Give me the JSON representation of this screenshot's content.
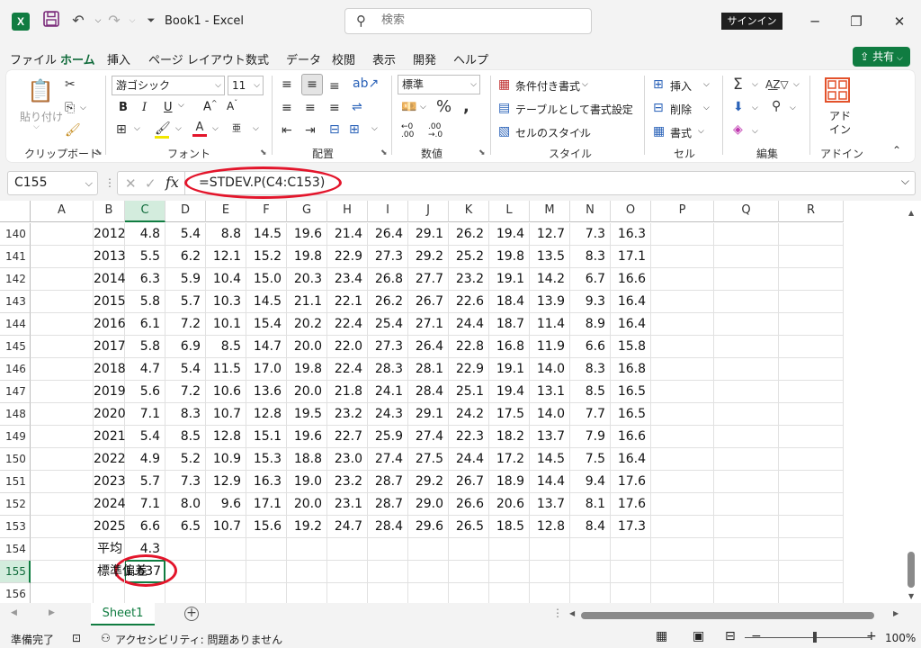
{
  "app": {
    "title": "Book1  -  Excel",
    "logo": "X",
    "sign_in": "サインイン"
  },
  "search": {
    "placeholder": "検索"
  },
  "tabs": [
    "ファイル",
    "ホーム",
    "挿入",
    "ページ レイアウト",
    "数式",
    "データ",
    "校閲",
    "表示",
    "開発",
    "ヘルプ"
  ],
  "active_tab": "ホーム",
  "share": {
    "label": "共有"
  },
  "ribbon": {
    "paste_label": "貼り付け",
    "font_name": "游ゴシック",
    "font_size": "11",
    "number_format": "標準",
    "conditional_format": "条件付き書式",
    "table_format": "テーブルとして書式設定",
    "cell_style": "セルのスタイル",
    "insert": "挿入",
    "delete": "削除",
    "format": "書式",
    "addin_label_1": "アド",
    "addin_label_2": "イン",
    "groups": {
      "clipboard": "クリップボード",
      "font": "フォント",
      "alignment": "配置",
      "number": "数値",
      "styles": "スタイル",
      "cells": "セル",
      "editing": "編集",
      "addins": "アドイン"
    }
  },
  "name_box": "C155",
  "formula": "=STDEV.P(C4:C153)",
  "columns": [
    "A",
    "B",
    "C",
    "D",
    "E",
    "F",
    "G",
    "H",
    "I",
    "J",
    "K",
    "L",
    "M",
    "N",
    "O",
    "P",
    "Q",
    "R"
  ],
  "selected_column": "C",
  "rows": [
    {
      "num": "140",
      "b": "2012",
      "vals": [
        "4.8",
        "5.4",
        "8.8",
        "14.5",
        "19.6",
        "21.4",
        "26.4",
        "29.1",
        "26.2",
        "19.4",
        "12.7",
        "7.3",
        "16.3"
      ]
    },
    {
      "num": "141",
      "b": "2013",
      "vals": [
        "5.5",
        "6.2",
        "12.1",
        "15.2",
        "19.8",
        "22.9",
        "27.3",
        "29.2",
        "25.2",
        "19.8",
        "13.5",
        "8.3",
        "17.1"
      ]
    },
    {
      "num": "142",
      "b": "2014",
      "vals": [
        "6.3",
        "5.9",
        "10.4",
        "15.0",
        "20.3",
        "23.4",
        "26.8",
        "27.7",
        "23.2",
        "19.1",
        "14.2",
        "6.7",
        "16.6"
      ]
    },
    {
      "num": "143",
      "b": "2015",
      "vals": [
        "5.8",
        "5.7",
        "10.3",
        "14.5",
        "21.1",
        "22.1",
        "26.2",
        "26.7",
        "22.6",
        "18.4",
        "13.9",
        "9.3",
        "16.4"
      ]
    },
    {
      "num": "144",
      "b": "2016",
      "vals": [
        "6.1",
        "7.2",
        "10.1",
        "15.4",
        "20.2",
        "22.4",
        "25.4",
        "27.1",
        "24.4",
        "18.7",
        "11.4",
        "8.9",
        "16.4"
      ]
    },
    {
      "num": "145",
      "b": "2017",
      "vals": [
        "5.8",
        "6.9",
        "8.5",
        "14.7",
        "20.0",
        "22.0",
        "27.3",
        "26.4",
        "22.8",
        "16.8",
        "11.9",
        "6.6",
        "15.8"
      ]
    },
    {
      "num": "146",
      "b": "2018",
      "vals": [
        "4.7",
        "5.4",
        "11.5",
        "17.0",
        "19.8",
        "22.4",
        "28.3",
        "28.1",
        "22.9",
        "19.1",
        "14.0",
        "8.3",
        "16.8"
      ]
    },
    {
      "num": "147",
      "b": "2019",
      "vals": [
        "5.6",
        "7.2",
        "10.6",
        "13.6",
        "20.0",
        "21.8",
        "24.1",
        "28.4",
        "25.1",
        "19.4",
        "13.1",
        "8.5",
        "16.5"
      ]
    },
    {
      "num": "148",
      "b": "2020",
      "vals": [
        "7.1",
        "8.3",
        "10.7",
        "12.8",
        "19.5",
        "23.2",
        "24.3",
        "29.1",
        "24.2",
        "17.5",
        "14.0",
        "7.7",
        "16.5"
      ]
    },
    {
      "num": "149",
      "b": "2021",
      "vals": [
        "5.4",
        "8.5",
        "12.8",
        "15.1",
        "19.6",
        "22.7",
        "25.9",
        "27.4",
        "22.3",
        "18.2",
        "13.7",
        "7.9",
        "16.6"
      ]
    },
    {
      "num": "150",
      "b": "2022",
      "vals": [
        "4.9",
        "5.2",
        "10.9",
        "15.3",
        "18.8",
        "23.0",
        "27.4",
        "27.5",
        "24.4",
        "17.2",
        "14.5",
        "7.5",
        "16.4"
      ]
    },
    {
      "num": "151",
      "b": "2023",
      "vals": [
        "5.7",
        "7.3",
        "12.9",
        "16.3",
        "19.0",
        "23.2",
        "28.7",
        "29.2",
        "26.7",
        "18.9",
        "14.4",
        "9.4",
        "17.6"
      ]
    },
    {
      "num": "152",
      "b": "2024",
      "vals": [
        "7.1",
        "8.0",
        "9.6",
        "17.1",
        "20.0",
        "23.1",
        "28.7",
        "29.0",
        "26.6",
        "20.6",
        "13.7",
        "8.1",
        "17.6"
      ]
    },
    {
      "num": "153",
      "b": "2025",
      "vals": [
        "6.6",
        "6.5",
        "10.7",
        "15.6",
        "19.2",
        "24.7",
        "28.4",
        "29.6",
        "26.5",
        "18.5",
        "12.8",
        "8.4",
        "17.3"
      ]
    }
  ],
  "summary": {
    "avg_row": "154",
    "avg_label": "平均",
    "avg_value": "4.3",
    "sd_row": "155",
    "sd_label": "標準偏差",
    "sd_value": "1.637",
    "empty_row": "156"
  },
  "sheet_tab": "Sheet1",
  "status": {
    "ready": "準備完了",
    "accessibility": "アクセシビリティ: 問題ありません",
    "zoom": "100%"
  },
  "colors": {
    "accent": "#107c41",
    "highlight": "#e3152b"
  }
}
